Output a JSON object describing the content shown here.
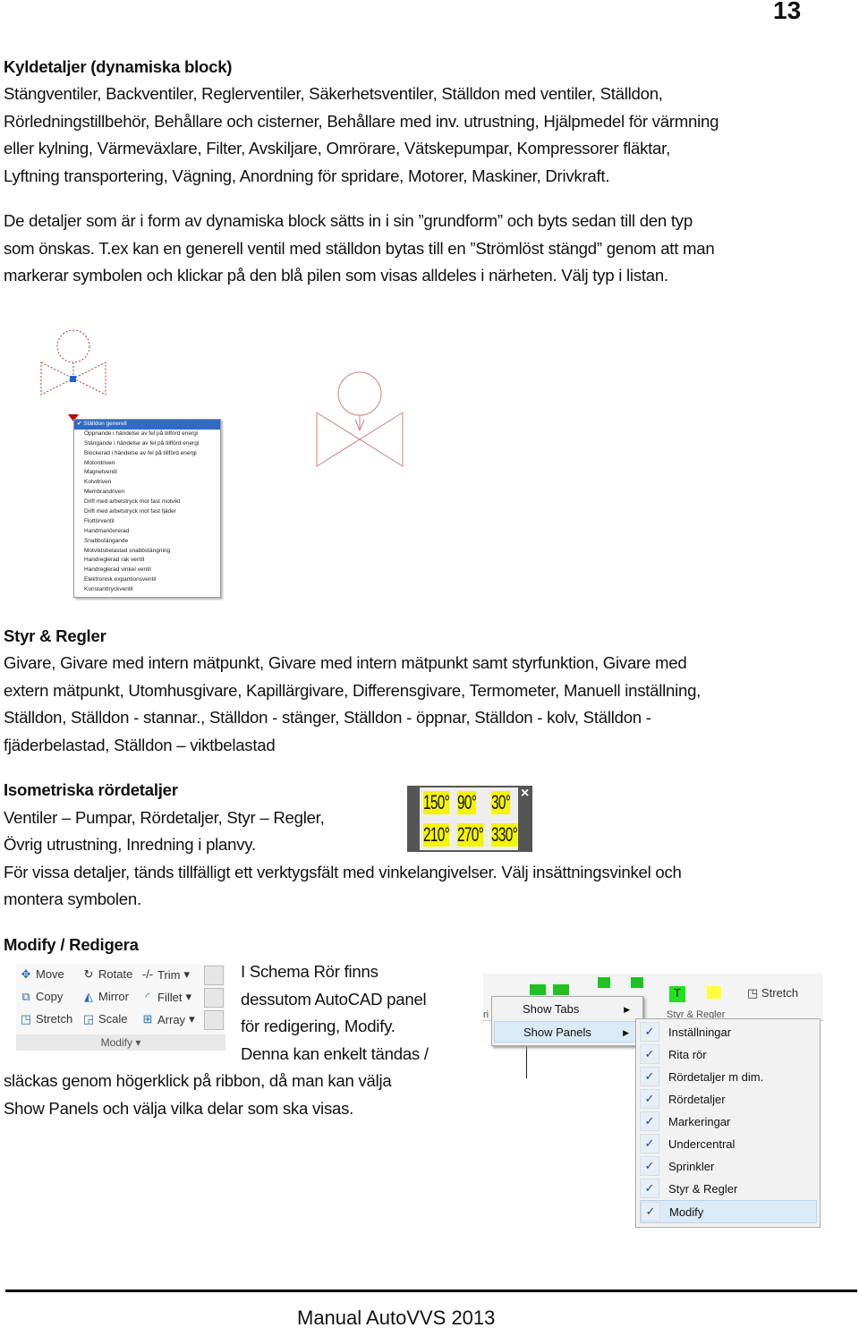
{
  "page_number": "13",
  "section1": {
    "heading": "Kyldetaljer (dynamiska block)",
    "lines": [
      "Stängventiler, Backventiler, Reglerventiler, Säkerhetsventiler, Ställdon med ventiler, Ställdon,",
      "Rörledningstillbehör, Behållare och cisterner, Behållare med inv. utrustning, Hjälpmedel för värmning",
      "eller kylning, Värmeväxlare, Filter, Avskiljare, Omrörare, Vätskepumpar, Kompressorer fläktar,",
      "Lyftning transportering, Vägning, Anordning för spridare, Motorer, Maskiner, Drivkraft."
    ],
    "para2": [
      "De detaljer som är i form av dynamiska block sätts in i sin ”grundform” och byts sedan till den typ",
      "som önskas. T.ex kan en generell ventil med ställdon bytas till en ”Strömlöst stängd” genom att man",
      "markerar symbolen och klickar på den blå pilen som visas alldeles i närheten. Välj typ i listan."
    ]
  },
  "dropdown": {
    "selected": "Ställdon generell",
    "items": [
      "Öppnande i händelse av fel på tillförd energi",
      "Stängande i händelse av fel på tillförd energi",
      "Blockerad i händelse av fel på tillförd energi",
      "Motordriven",
      "Magnetventil",
      "Kolvdriven",
      "Membrandriven",
      "Drift med arbetstryck mot fast motvikt",
      "Drift med arbetstryck mot fast fjäder",
      "Flottörventil",
      "Handmanövrerad",
      "Snabbstängande",
      "Motviktsbelastad snabbstängning",
      "Handreglerad rak ventil",
      "Handreglerad vinkel ventil",
      "Elektronisk expantionsventil",
      "Konstanttryckventil"
    ]
  },
  "section2": {
    "heading": "Styr & Regler",
    "lines": [
      "Givare, Givare med intern mätpunkt, Givare med intern mätpunkt samt styrfunktion, Givare med",
      "extern mätpunkt, Utomhusgivare, Kapillärgivare, Differensgivare, Termometer, Manuell inställning,",
      "Ställdon, Ställdon - stannar., Ställdon - stänger, Ställdon - öppnar, Ställdon - kolv, Ställdon -",
      "fjäderbelastad, Ställdon – viktbelastad"
    ]
  },
  "section3": {
    "heading": "Isometriska rördetaljer",
    "lines": [
      "Ventiler – Pumpar, Rördetaljer, Styr – Regler,",
      "Övrig utrustning, Inredning i planvy.",
      "För vissa detaljer, tänds tillfälligt ett verktygsfält med vinkelangivelser. Välj insättningsvinkel och",
      "montera symbolen."
    ],
    "angles": [
      "150°",
      "90°",
      "30°",
      "210°",
      "270°",
      "330°"
    ],
    "close": "×"
  },
  "section4": {
    "heading": "Modify / Redigera",
    "lines": [
      "I Schema Rör finns",
      "dessutom AutoCAD panel",
      "för redigering, Modify.",
      "Denna kan enkelt tändas /",
      "släckas genom högerklick på ribbon, då man kan välja",
      "Show Panels och välja vilka delar som ska visas."
    ],
    "modify_panel": {
      "title": "Modify",
      "tools": [
        "Move",
        "Rotate",
        "Trim",
        "Copy",
        "Mirror",
        "Fillet",
        "Stretch",
        "Scale",
        "Array"
      ]
    },
    "ribbon": {
      "stretch": "Stretch",
      "panel_label": "Styr & Regler",
      "cut_label": "ri"
    },
    "context_menu": [
      "Show Tabs",
      "Show Panels"
    ],
    "panels_submenu": [
      "Inställningar",
      "Rita rör",
      "Rördetaljer m dim.",
      "Rördetaljer",
      "Markeringar",
      "Undercentral",
      "Sprinkler",
      "Styr & Regler",
      "Modify"
    ]
  },
  "footer": "Manual AutoVVS 2013",
  "colors": {
    "symbol_red": "#cc3333",
    "selection_blue": "#316ac5",
    "angle_yellow": "#f5f500"
  }
}
